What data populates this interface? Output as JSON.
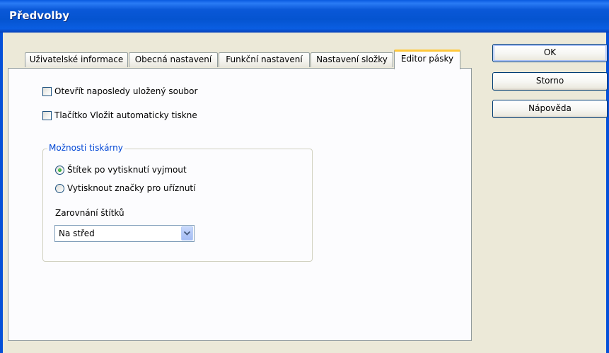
{
  "window": {
    "title": "Předvolby"
  },
  "tabs": [
    {
      "label": "Uživatelské informace"
    },
    {
      "label": "Obecná nastavení"
    },
    {
      "label": "Funkční nastavení"
    },
    {
      "label": "Nastavení složky"
    },
    {
      "label": "Editor pásky",
      "active": true
    }
  ],
  "options": {
    "open_last": {
      "label": "Otevřít naposledy uložený soubor",
      "checked": false
    },
    "insert_prints": {
      "label": "Tlačítko Vložit automaticky tiskne",
      "checked": false
    }
  },
  "printer_options": {
    "title": "Možnosti tiskárny",
    "radio_cut": {
      "label": "Štítek po vytisknutí vyjmout",
      "checked": true
    },
    "radio_marks": {
      "label": "Vytisknout značky pro uříznutí",
      "checked": false
    },
    "alignment_label": "Zarovnání štítků",
    "alignment_value": "Na střed"
  },
  "buttons": {
    "ok": "OK",
    "cancel": "Storno",
    "help": "Nápověda"
  },
  "colors": {
    "title_bar": "#0a58d8",
    "group_title": "#0046d5",
    "active_tab_accent": "#ffc83c"
  }
}
